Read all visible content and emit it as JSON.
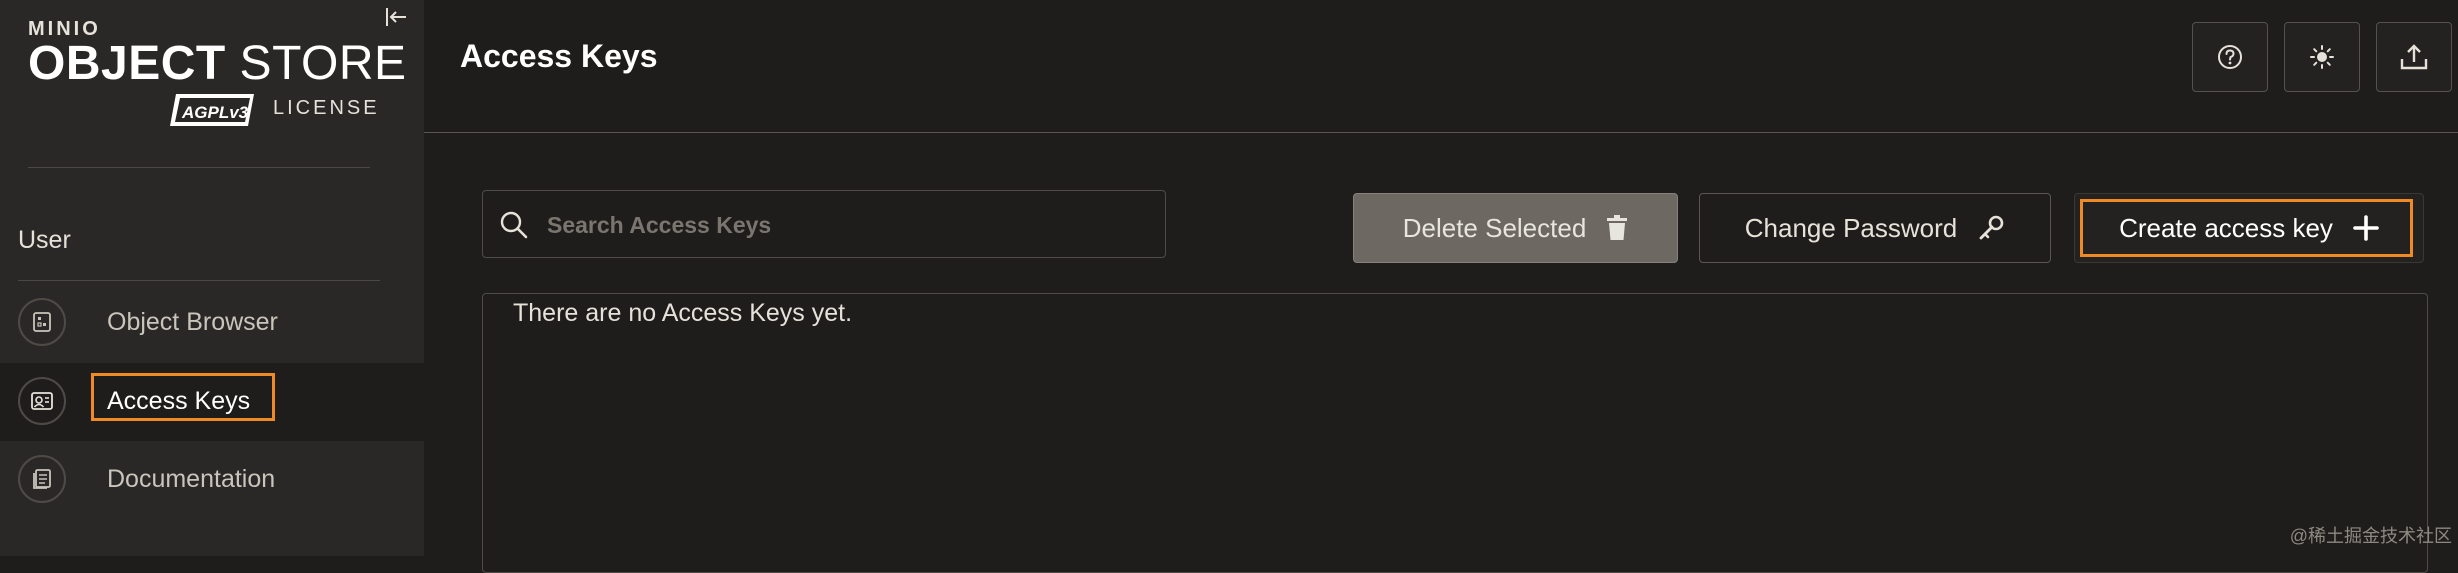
{
  "brand": {
    "small": "MINIO",
    "main_bold": "OBJECT",
    "main_rest": "STORE",
    "badge": "AGPLv3",
    "license": "LICENSE"
  },
  "sidebar": {
    "section": "User",
    "items": [
      {
        "label": "Object Browser",
        "icon": "object-browser-icon"
      },
      {
        "label": "Access Keys",
        "icon": "access-keys-icon",
        "active": true
      },
      {
        "label": "Documentation",
        "icon": "documentation-icon"
      }
    ]
  },
  "header": {
    "title": "Access Keys",
    "buttons": [
      "help-icon",
      "theme-toggle-icon",
      "upload-icon"
    ]
  },
  "toolbar": {
    "search_placeholder": "Search Access Keys",
    "delete_label": "Delete Selected",
    "change_password_label": "Change Password",
    "create_label": "Create access key"
  },
  "list": {
    "empty_message": "There are no Access Keys yet."
  },
  "watermark": "@稀土掘金技术社区",
  "colors": {
    "accent": "#f08a24",
    "background": "#1e1d1b",
    "sidebar": "#2a2826"
  }
}
